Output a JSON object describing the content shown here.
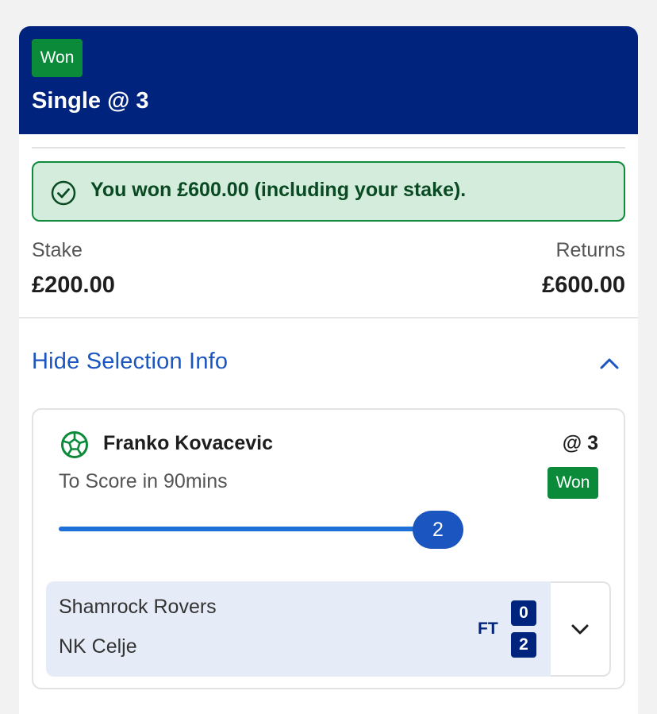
{
  "bet": {
    "status_badge": "Won",
    "title": "Single @ 3"
  },
  "banner": {
    "message": "You won £600.00 (including your stake).",
    "icon": "check-circle-icon"
  },
  "summary": {
    "stake_label": "Stake",
    "stake_value": "£200.00",
    "returns_label": "Returns",
    "returns_value": "£600.00"
  },
  "selection_toggle": {
    "label": "Hide Selection Info",
    "icon": "chevron-up-icon"
  },
  "selection": {
    "player": "Franko Kovacevic",
    "odds": "@ 3",
    "market": "To Score in 90mins",
    "status_badge": "Won",
    "progress_value": "2",
    "progress_fraction": 1.0,
    "sport_icon": "football-icon"
  },
  "match": {
    "home_team": "Shamrock Rovers",
    "away_team": "NK Celje",
    "status": "FT",
    "home_score": "0",
    "away_score": "2",
    "expand_icon": "chevron-down-icon"
  },
  "colors": {
    "header_bg": "#00237d",
    "won_green": "#0b8a3a",
    "banner_bg": "#d3ecdc",
    "link_blue": "#1b55c0",
    "progress_blue": "#1f6fd9",
    "match_bg": "#e6ebf8"
  }
}
